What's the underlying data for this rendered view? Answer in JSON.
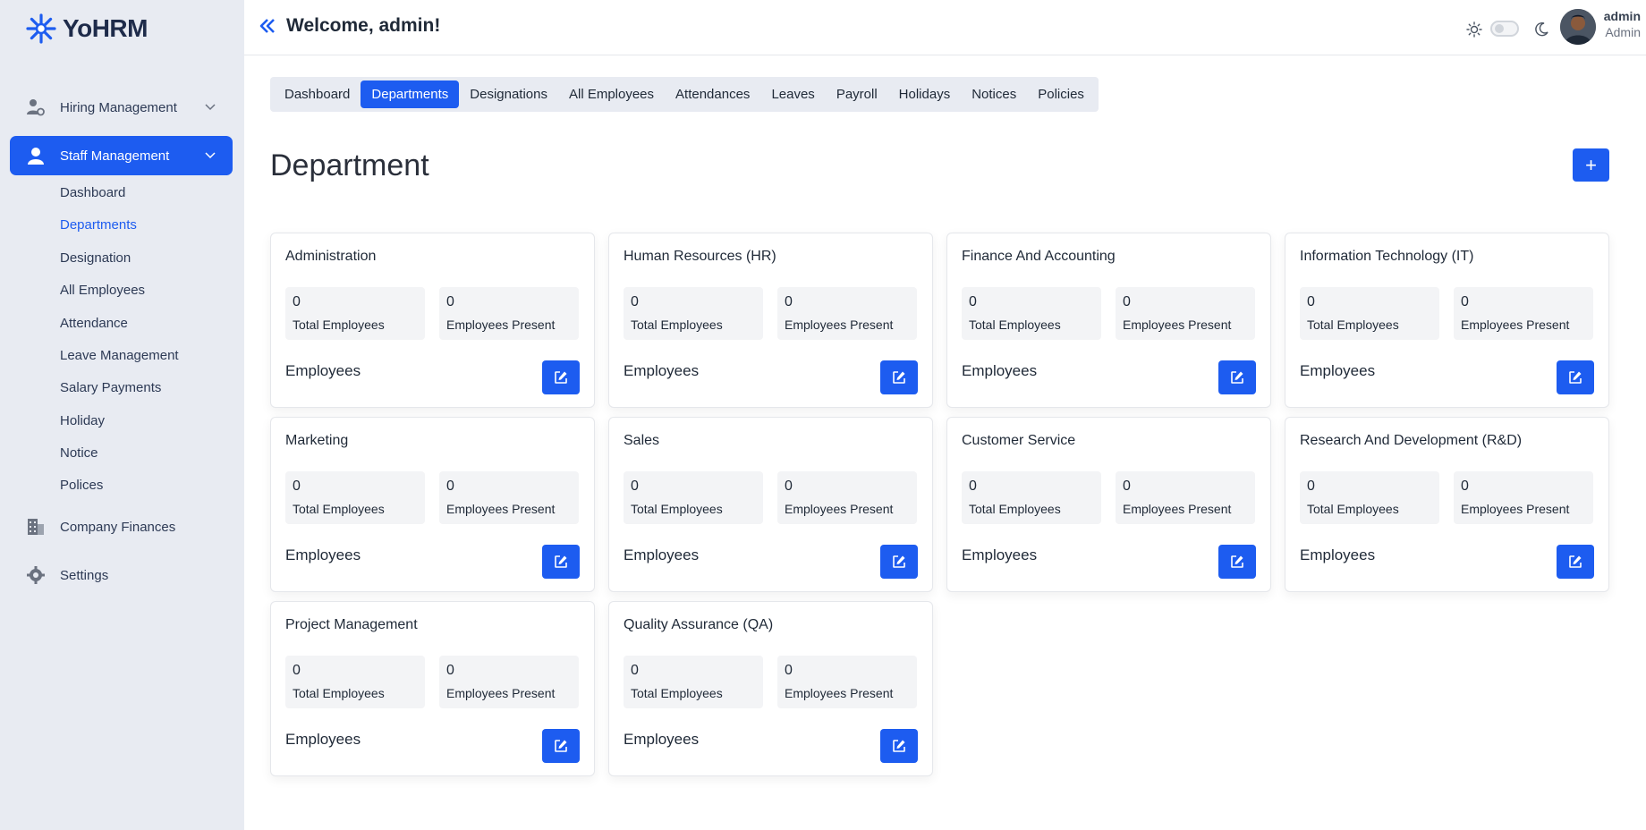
{
  "app": {
    "name": "YoHRM"
  },
  "sidebar": {
    "groups": [
      {
        "label": "Hiring Management",
        "icon": "users-cog-icon"
      },
      {
        "label": "Staff Management",
        "icon": "user-icon"
      },
      {
        "label": "Company Finances",
        "icon": "building-icon"
      },
      {
        "label": "Settings",
        "icon": "gear-icon"
      }
    ],
    "staff_items": [
      {
        "label": "Dashboard"
      },
      {
        "label": "Departments"
      },
      {
        "label": "Designation"
      },
      {
        "label": "All Employees"
      },
      {
        "label": "Attendance"
      },
      {
        "label": "Leave Management"
      },
      {
        "label": "Salary Payments"
      },
      {
        "label": "Holiday"
      },
      {
        "label": "Notice"
      },
      {
        "label": "Polices"
      }
    ]
  },
  "header": {
    "welcome": "Welcome, admin!",
    "user_name": "admin",
    "user_role": "Admin"
  },
  "tabs": [
    {
      "label": "Dashboard"
    },
    {
      "label": "Departments"
    },
    {
      "label": "Designations"
    },
    {
      "label": "All Employees"
    },
    {
      "label": "Attendances"
    },
    {
      "label": "Leaves"
    },
    {
      "label": "Payroll"
    },
    {
      "label": "Holidays"
    },
    {
      "label": "Notices"
    },
    {
      "label": "Policies"
    }
  ],
  "page": {
    "title": "Department",
    "add_label": "+"
  },
  "card_labels": {
    "total": "Total Employees",
    "present": "Employees Present",
    "employees": "Employees"
  },
  "departments": [
    {
      "name": "Administration",
      "total": "0",
      "present": "0"
    },
    {
      "name": "Human Resources (HR)",
      "total": "0",
      "present": "0"
    },
    {
      "name": "Finance And Accounting",
      "total": "0",
      "present": "0"
    },
    {
      "name": "Information Technology (IT)",
      "total": "0",
      "present": "0"
    },
    {
      "name": "Marketing",
      "total": "0",
      "present": "0"
    },
    {
      "name": "Sales",
      "total": "0",
      "present": "0"
    },
    {
      "name": "Customer Service",
      "total": "0",
      "present": "0"
    },
    {
      "name": "Research And Development (R&D)",
      "total": "0",
      "present": "0"
    },
    {
      "name": "Project Management",
      "total": "0",
      "present": "0"
    },
    {
      "name": "Quality Assurance (QA)",
      "total": "0",
      "present": "0"
    }
  ],
  "colors": {
    "accent": "#1d5cf0",
    "sidebar_bg": "#e8ebf2"
  }
}
